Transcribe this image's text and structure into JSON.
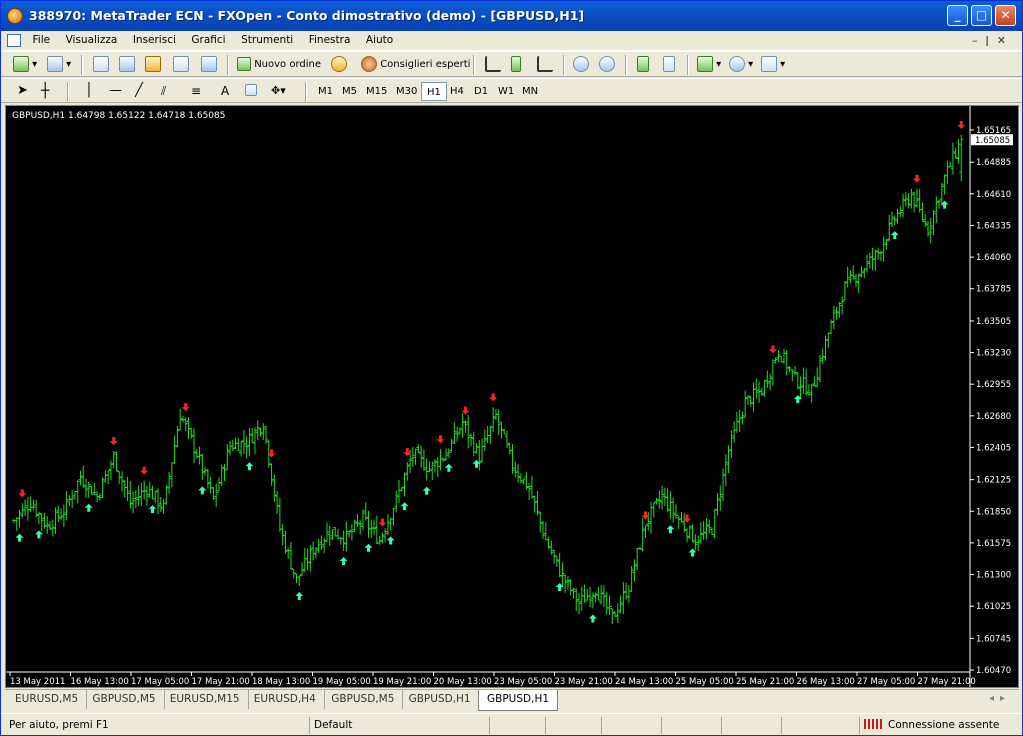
{
  "window": {
    "title": "388970: MetaTrader ECN - FXOpen - Conto dimostrativo (demo) - [GBPUSD,H1]",
    "minimize": "_",
    "maximize": "□",
    "close": "✕"
  },
  "menu": [
    "File",
    "Visualizza",
    "Inserisci",
    "Grafici",
    "Strumenti",
    "Finestra",
    "Aiuto"
  ],
  "toolbar": {
    "new_order": "Nuovo ordine",
    "expert_advisors": "Consiglieri esperti",
    "text_tool": "A"
  },
  "timeframes": [
    "M1",
    "M5",
    "M15",
    "M30",
    "H1",
    "H4",
    "D1",
    "W1",
    "MN"
  ],
  "active_timeframe": "H1",
  "chart_info": "GBPUSD,H1  1.64798 1.65122 1.64718 1.65085",
  "chart_data": {
    "type": "ohlc",
    "symbol": "GBPUSD",
    "timeframe": "H1",
    "last": {
      "open": 1.64798,
      "high": 1.65122,
      "low": 1.64718,
      "close": 1.65085
    },
    "bar_color": "#22dd22",
    "background": "#000000",
    "ylim": [
      1.6047,
      1.65165
    ],
    "y_ticks": [
      "1.65165",
      "1.64885",
      "1.64610",
      "1.64335",
      "1.64060",
      "1.63785",
      "1.63505",
      "1.63230",
      "1.62955",
      "1.62680",
      "1.62405",
      "1.62125",
      "1.61850",
      "1.61575",
      "1.61300",
      "1.61025",
      "1.60745",
      "1.60470"
    ],
    "current_price_label": "1.65085",
    "x_ticks": [
      "13 May 2011",
      "16 May 13:00",
      "17 May 05:00",
      "17 May 21:00",
      "18 May 13:00",
      "19 May 05:00",
      "19 May 21:00",
      "20 May 13:00",
      "23 May 05:00",
      "23 May 21:00",
      "24 May 13:00",
      "25 May 05:00",
      "25 May 21:00",
      "26 May 13:00",
      "27 May 05:00",
      "27 May 21:00"
    ],
    "path_keypoints": [
      [
        0,
        1.6177
      ],
      [
        6,
        1.6193
      ],
      [
        12,
        1.6172
      ],
      [
        18,
        1.6185
      ],
      [
        24,
        1.6215
      ],
      [
        30,
        1.6198
      ],
      [
        36,
        1.6232
      ],
      [
        42,
        1.6192
      ],
      [
        48,
        1.6205
      ],
      [
        54,
        1.6188
      ],
      [
        60,
        1.627
      ],
      [
        66,
        1.6235
      ],
      [
        72,
        1.6195
      ],
      [
        78,
        1.6242
      ],
      [
        84,
        1.6245
      ],
      [
        90,
        1.6262
      ],
      [
        96,
        1.617
      ],
      [
        102,
        1.6125
      ],
      [
        108,
        1.6152
      ],
      [
        114,
        1.6168
      ],
      [
        120,
        1.6162
      ],
      [
        126,
        1.6178
      ],
      [
        132,
        1.616
      ],
      [
        138,
        1.6195
      ],
      [
        144,
        1.6235
      ],
      [
        150,
        1.6222
      ],
      [
        156,
        1.6235
      ],
      [
        162,
        1.6262
      ],
      [
        168,
        1.6232
      ],
      [
        174,
        1.6268
      ],
      [
        180,
        1.6225
      ],
      [
        186,
        1.6205
      ],
      [
        192,
        1.616
      ],
      [
        198,
        1.6128
      ],
      [
        204,
        1.6105
      ],
      [
        210,
        1.6118
      ],
      [
        216,
        1.6092
      ],
      [
        222,
        1.612
      ],
      [
        228,
        1.6175
      ],
      [
        234,
        1.6198
      ],
      [
        240,
        1.6178
      ],
      [
        246,
        1.616
      ],
      [
        252,
        1.617
      ],
      [
        258,
        1.6238
      ],
      [
        264,
        1.628
      ],
      [
        270,
        1.629
      ],
      [
        276,
        1.6325
      ],
      [
        282,
        1.63
      ],
      [
        288,
        1.629
      ],
      [
        294,
        1.634
      ],
      [
        300,
        1.638
      ],
      [
        306,
        1.6395
      ],
      [
        312,
        1.641
      ],
      [
        318,
        1.644
      ],
      [
        324,
        1.646
      ],
      [
        330,
        1.643
      ],
      [
        336,
        1.6475
      ],
      [
        342,
        1.6508
      ]
    ],
    "down_arrows": [
      3,
      36,
      47,
      62,
      93,
      133,
      142,
      154,
      163,
      173,
      228,
      243,
      274,
      326,
      348
    ],
    "up_arrows": [
      2,
      9,
      27,
      50,
      68,
      85,
      103,
      119,
      128,
      136,
      141,
      149,
      157,
      167,
      197,
      209,
      237,
      245,
      283,
      318,
      336
    ],
    "arrow_up_color": "#33ffaa",
    "arrow_down_color": "#ff2222"
  },
  "tabs": [
    "EURUSD,M5",
    "GBPUSD,M5",
    "EURUSD,M15",
    "EURUSD,H4",
    "GBPUSD,M5",
    "GBPUSD,H1",
    "GBPUSD,H1"
  ],
  "active_tab_index": 6,
  "status": {
    "help": "Per aiuto, premi F1",
    "profile": "Default",
    "connection": "Connessione assente"
  }
}
